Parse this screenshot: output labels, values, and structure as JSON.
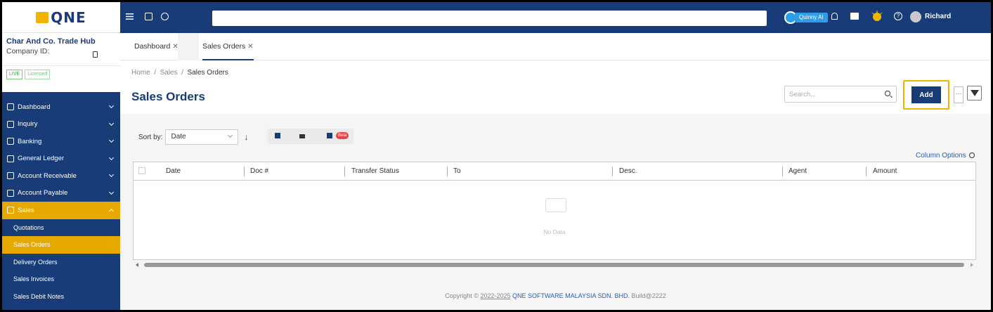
{
  "app": {
    "logo_text": "QNE",
    "company_name": "Char And Co. Trade Hub",
    "company_id_label": "Company ID:",
    "badges": [
      "LIVE",
      "Licensed"
    ]
  },
  "header": {
    "quinny_label": "Quinny AI",
    "user_name": "Richard"
  },
  "sidebar": {
    "items": [
      {
        "label": "Dashboard",
        "icon": "monitor-icon"
      },
      {
        "label": "Inquiry",
        "icon": "inquiry-icon"
      },
      {
        "label": "Banking",
        "icon": "bank-icon"
      },
      {
        "label": "General Ledger",
        "icon": "ledger-icon"
      },
      {
        "label": "Account Receivable",
        "icon": "receivable-icon"
      },
      {
        "label": "Account Payable",
        "icon": "payable-icon"
      },
      {
        "label": "Sales",
        "icon": "cart-icon"
      }
    ],
    "sub_items": [
      "Quotations",
      "Sales Orders",
      "Delivery Orders",
      "Sales Invoices",
      "Sales Debit Notes"
    ]
  },
  "tabs": [
    {
      "label": "Dashboard"
    },
    {
      "label": "Sales Orders"
    }
  ],
  "breadcrumb": {
    "home": "Home",
    "sep": "/",
    "sales": "Sales",
    "current": "Sales Orders"
  },
  "main": {
    "title": "Sales Orders",
    "search_placeholder": "Search...",
    "add_label": "Add",
    "more_label": "···",
    "sort_label": "Sort by:",
    "sort_value": "Date",
    "sort_arrow": "↓",
    "beta_label": "Beta",
    "column_options": "Column Options",
    "columns": [
      "Date",
      "Doc #",
      "Transfer Status",
      "To",
      "Desc.",
      "Agent",
      "Amount"
    ],
    "empty_text": "No Data"
  },
  "footer": {
    "copyright": "Copyright ©",
    "years": "2022-2025",
    "company": "QNE SOFTWARE MALAYSIA SDN. BHD.",
    "build": "Build@2222"
  },
  "colors": {
    "brand_navy": "#173c77",
    "accent_gold": "#e7a900",
    "highlight": "#f0b400"
  }
}
